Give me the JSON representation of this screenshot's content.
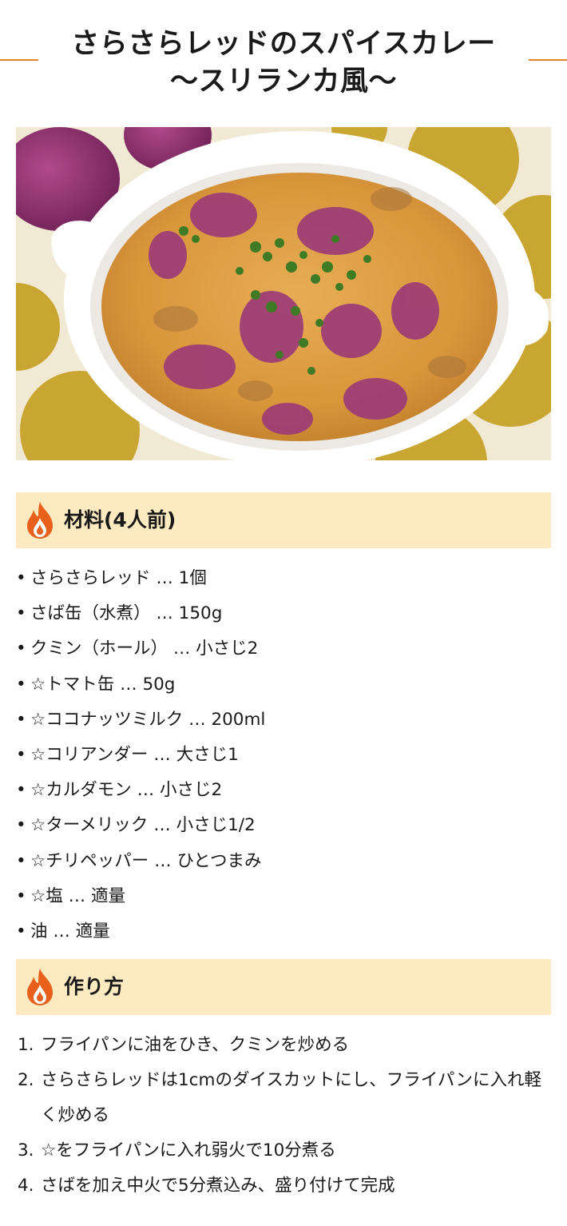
{
  "title": {
    "line1": "さらさらレッドのスパイスカレー",
    "line2": "〜スリランカ風〜"
  },
  "hero_image": {
    "description_icon": "curry-bowl-photo"
  },
  "ingredients_section": {
    "heading": "材料(4人前)",
    "icon": "flame-icon",
    "bullet": "•",
    "items": [
      "さらさらレッド … 1個",
      "さば缶（水煮） … 150g",
      "クミン（ホール） … 小さじ2",
      "☆トマト缶 … 50g",
      "☆ココナッツミルク … 200ml",
      "☆コリアンダー … 大さじ1",
      "☆カルダモン … 小さじ2",
      "☆ターメリック … 小さじ1/2",
      "☆チリペッパー … ひとつまみ",
      "☆塩 … 適量",
      "油 … 適量"
    ]
  },
  "steps_section": {
    "heading": "作り方",
    "icon": "flame-icon",
    "items": [
      {
        "num": "1.",
        "text": "フライパンに油をひき、クミンを炒める"
      },
      {
        "num": "2.",
        "text": "さらさらレッドは1cmのダイスカットにし、フライパンに入れ軽く炒める"
      },
      {
        "num": "3.",
        "text": "☆をフライパンに入れ弱火で10分煮る"
      },
      {
        "num": "4.",
        "text": "さばを加え中火で5分煮込み、盛り付けて完成"
      }
    ]
  },
  "colors": {
    "accent_line": "#e8822a",
    "section_bg": "#fdeac0",
    "flame": "#e8601c",
    "curry": "#d99a3e",
    "onion": "#8a2a6a",
    "fabric_yellow": "#c9a531"
  }
}
